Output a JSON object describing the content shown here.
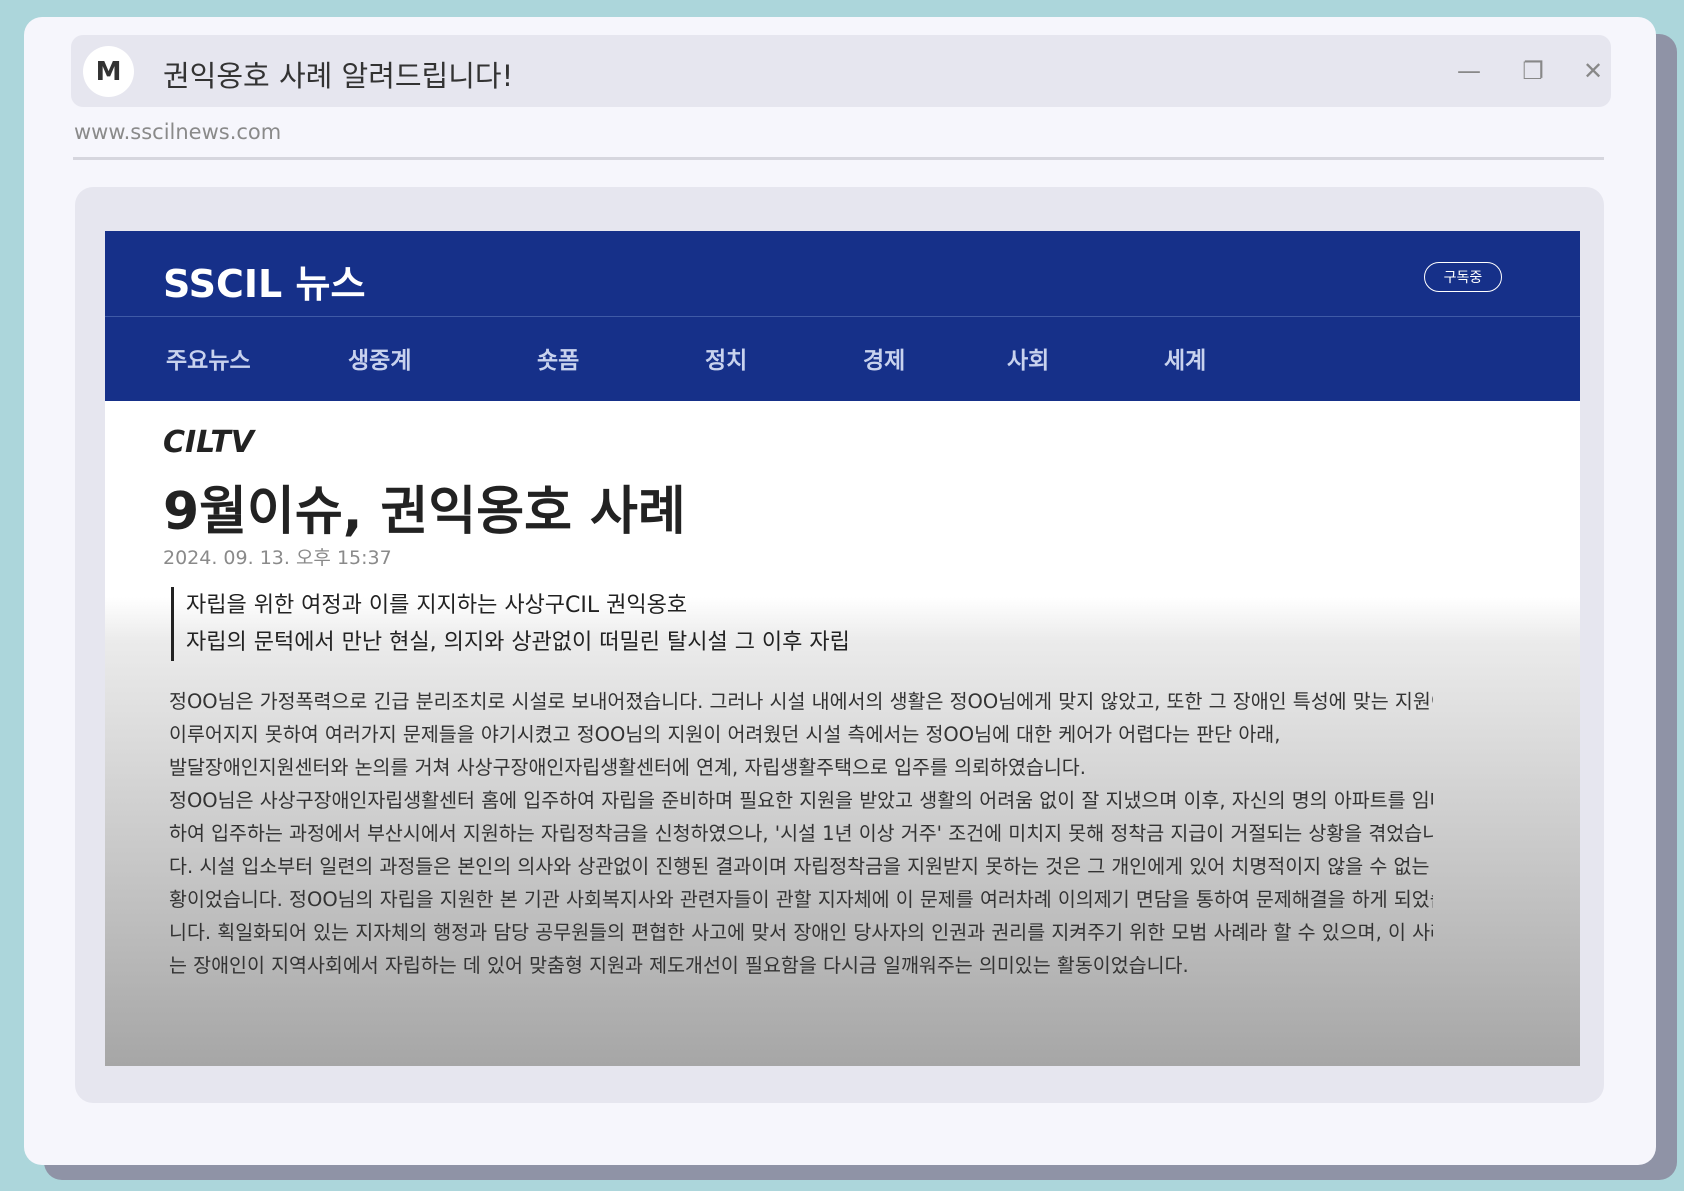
{
  "window": {
    "logo_letter": "M",
    "title": "권익옹호 사례 알려드립니다!",
    "controls": {
      "minimize_glyph": "—",
      "copy_glyph": "❐",
      "close_glyph": "✕"
    },
    "url": "www.sscilnews.com"
  },
  "news": {
    "brand": "SSCIL 뉴스",
    "subscribe_label": "구독중",
    "nav": [
      "주요뉴스",
      "생중계",
      "숏폼",
      "정치",
      "경제",
      "사회",
      "세계"
    ],
    "colors": {
      "header_bg": "#163089",
      "nav_text": "#c8d2ee"
    }
  },
  "article": {
    "category": "CILTV",
    "headline": "9월이슈, 권익옹호 사례",
    "date": "2024. 09. 13. 오후 15:37",
    "subheadlines": [
      "자립을 위한 여정과 이를 지지하는 사상구CIL 권익옹호",
      "자립의 문턱에서 만난 현실, 의지와 상관없이 떠밀린 탈시설 그 이후 자립"
    ],
    "body_lines": [
      "정OO님은 가정폭력으로 긴급 분리조치로 시설로 보내어졌습니다.  그러나 시설 내에서의 생활은 정OO님에게 맞지 않았고, 또한 그 장애인 특성에 맞는 지원이",
      "이루어지지 못하여 여러가지 문제들을 야기시켰고 정OO님의 지원이 어려웠던 시설 측에서는 정OO님에 대한 케어가 어렵다는 판단 아래,",
      "발달장애인지원센터와  논의를 거쳐 사상구장애인자립생활센터에 연계, 자립생활주택으로 입주를 의뢰하였습니다.",
      "정OO님은 사상구장애인자립생활센터 홈에 입주하여 자립을 준비하며 필요한 지원을 받았고 생활의 어려움 없이 잘 지냈으며 이후, 자신의 명의 아파트를 임대",
      "하여 입주하는 과정에서 부산시에서 지원하는 자립정착금을 신청하였으나,  '시설 1년 이상 거주' 조건에 미치지 못해 정착금 지급이 거절되는 상황을 겪었습니",
      "다. 시설 입소부터 일련의 과정들은 본인의 의사와 상관없이 진행된 결과이며 자립정착금을 지원받지 못하는 것은 그 개인에게 있어 치명적이지 않을 수 없는 상",
      "황이었습니다. 정OO님의 자립을 지원한 본 기관 사회복지사와 관련자들이 관할 지자체에 이 문제를 여러차례 이의제기 면담을 통하여 문제해결을 하게 되었습",
      "니다. 획일화되어 있는 지자체의 행정과 담당 공무원들의 편협한 사고에 맞서 장애인 당사자의 인권과 권리를 지켜주기 위한 모범 사례라 할 수 있으며,  이 사례",
      "는 장애인이 지역사회에서 자립하는 데 있어 맞춤형 지원과 제도개선이 필요함을 다시금 일깨워주는 의미있는 활동이었습니다."
    ]
  }
}
